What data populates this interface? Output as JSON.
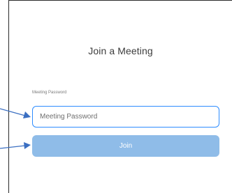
{
  "dialog": {
    "title": "Join a Meeting",
    "password_label": "Meeting Password",
    "password_placeholder": "Meeting Password",
    "password_value": "",
    "join_label": "Join"
  },
  "colors": {
    "input_border": "#2d8cff",
    "join_button_disabled": "#8fbce8",
    "annotation_arrow": "#3b6fc2"
  }
}
